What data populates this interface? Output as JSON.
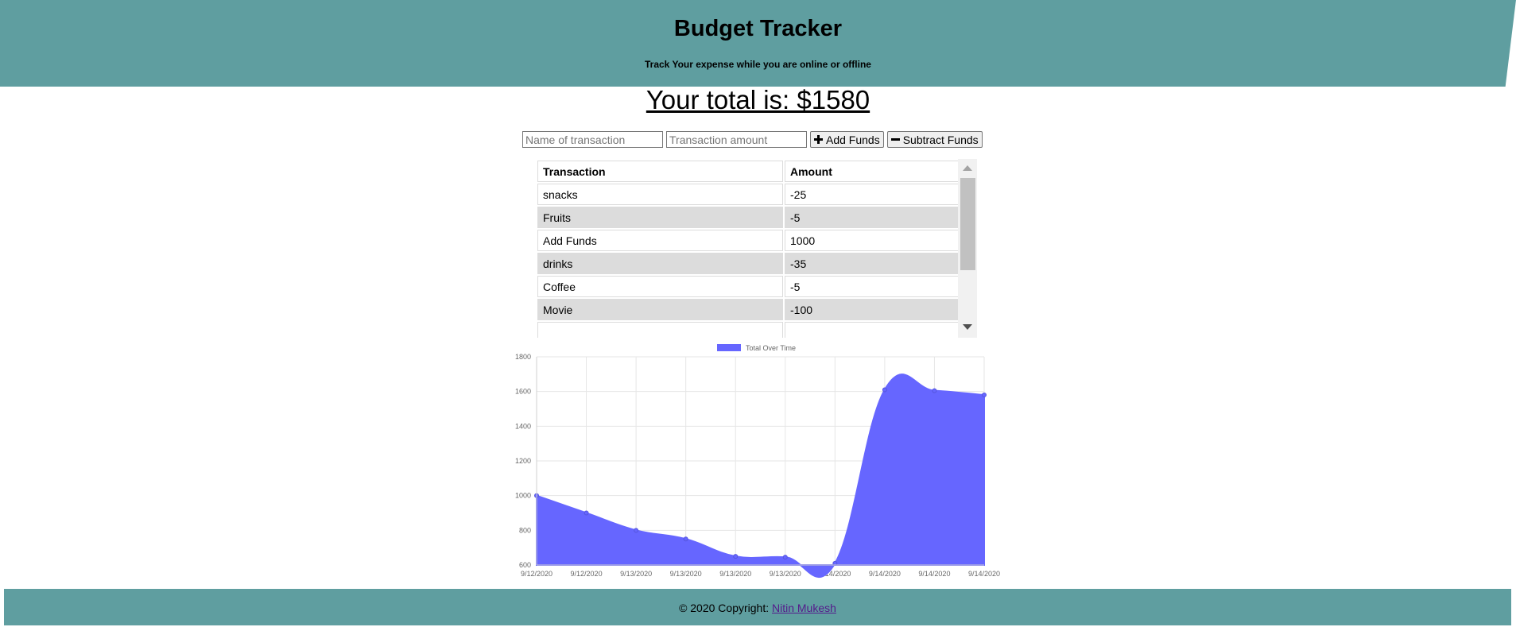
{
  "header": {
    "title": "Budget Tracker",
    "subtitle": "Track Your expense while you are online or offline"
  },
  "total": {
    "label": "Your total is: $1580"
  },
  "form": {
    "name_placeholder": "Name of transaction",
    "amount_placeholder": "Transaction amount",
    "add_label": "Add Funds",
    "subtract_label": "Subtract Funds"
  },
  "table": {
    "headers": [
      "Transaction",
      "Amount"
    ],
    "rows": [
      {
        "name": "snacks",
        "amount": "-25"
      },
      {
        "name": "Fruits",
        "amount": "-5"
      },
      {
        "name": "Add Funds",
        "amount": "1000"
      },
      {
        "name": "drinks",
        "amount": "-35"
      },
      {
        "name": "Coffee",
        "amount": "-5"
      },
      {
        "name": "Movie",
        "amount": "-100"
      }
    ]
  },
  "chart_data": {
    "type": "area",
    "x": [
      "9/12/2020",
      "9/12/2020",
      "9/13/2020",
      "9/13/2020",
      "9/13/2020",
      "9/13/2020",
      "9/14/2020",
      "9/14/2020",
      "9/14/2020",
      "9/14/2020"
    ],
    "series": [
      {
        "name": "Total Over Time",
        "values": [
          1000,
          900,
          800,
          750,
          650,
          645,
          610,
          1610,
          1605,
          1580
        ],
        "color": "#6666ff"
      }
    ],
    "ylim": [
      600,
      1800
    ],
    "yticks": [
      600,
      800,
      1000,
      1200,
      1400,
      1600,
      1800
    ],
    "grid": true,
    "legend": "top"
  },
  "footer": {
    "copyright": "© 2020 Copyright: ",
    "author": "Nitin Mukesh"
  },
  "colors": {
    "header_bg": "#5f9ea0",
    "chart_fill": "#6666ff",
    "alt_row": "#dcdcdc"
  },
  "icons": {
    "add": "plus-icon",
    "subtract": "minus-icon"
  }
}
